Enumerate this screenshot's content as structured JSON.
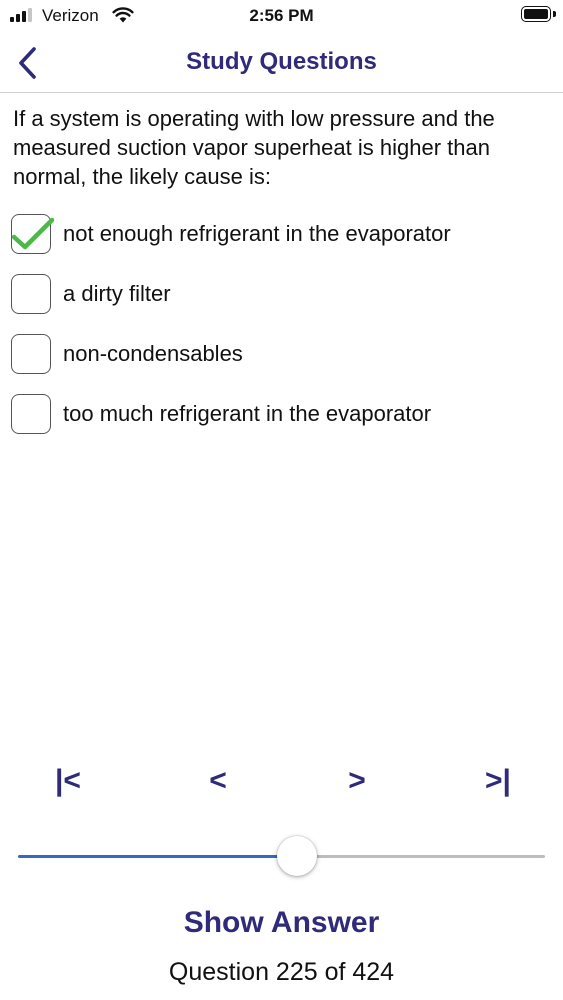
{
  "status_bar": {
    "carrier": "Verizon",
    "time": "2:56 PM",
    "signal_bars": 3,
    "signal_total": 4,
    "battery_level": 1.0
  },
  "nav": {
    "title": "Study Questions",
    "back_icon": "chevron-left-icon"
  },
  "question": {
    "text": "If a system is operating with low pressure and the measured suction vapor superheat is higher than normal, the likely cause is:"
  },
  "options": [
    {
      "label": "not enough refrigerant in the evaporator",
      "checked": true
    },
    {
      "label": "a dirty filter",
      "checked": false
    },
    {
      "label": "non-condensables",
      "checked": false
    },
    {
      "label": "too much refrigerant in the evaporator",
      "checked": false
    }
  ],
  "pager": {
    "first": "|<",
    "prev": "<",
    "next": ">",
    "last": ">|"
  },
  "slider": {
    "current": 225,
    "total": 424
  },
  "show_answer_label": "Show Answer",
  "counter_text": "Question 225 of 424",
  "colors": {
    "accent": "#2f2a7a",
    "slider_fill": "#2f6ac9",
    "check": "#4cb848"
  }
}
